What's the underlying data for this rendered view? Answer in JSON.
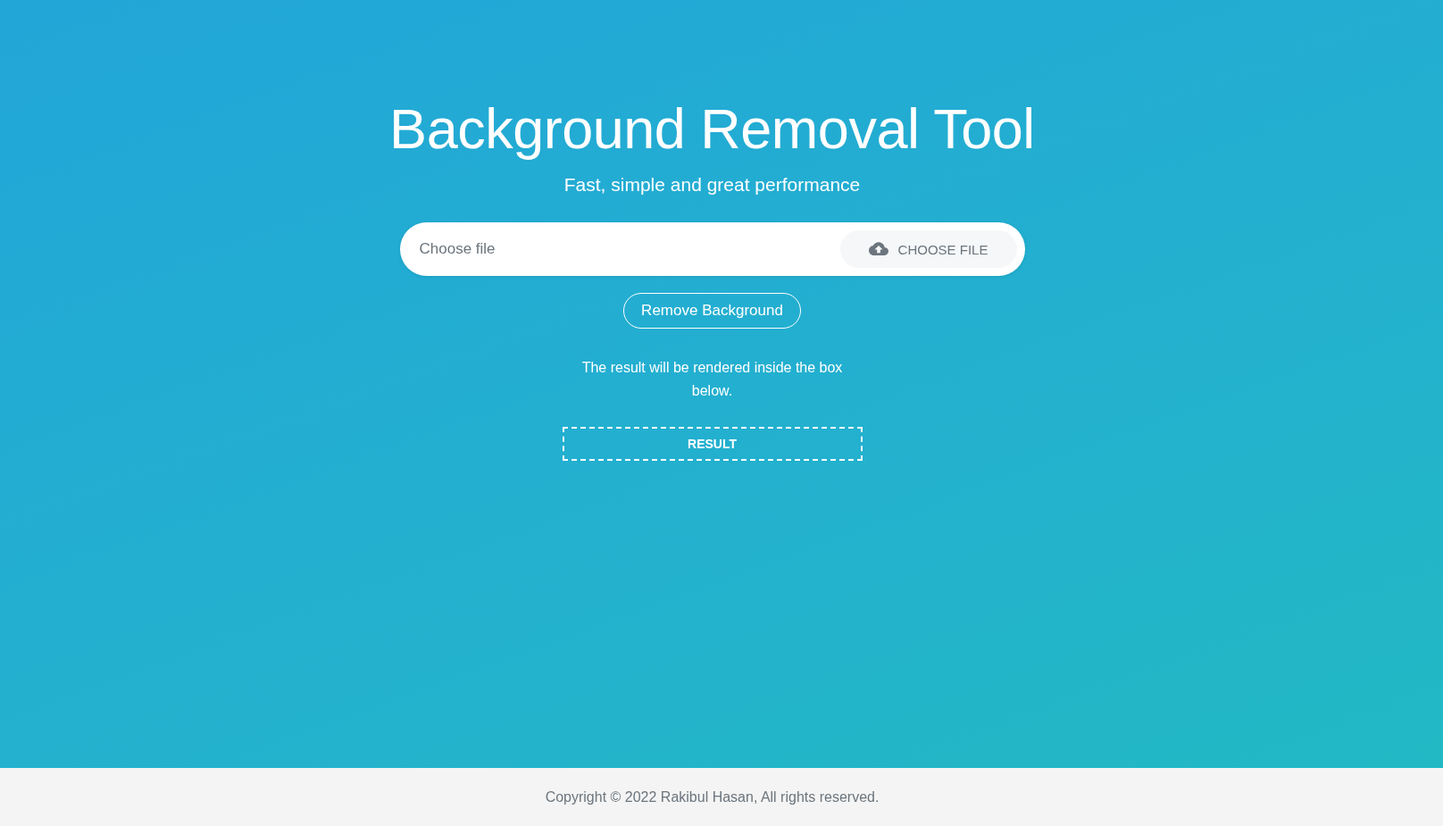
{
  "title": "Background Removal Tool",
  "subtitle": "Fast, simple and great performance",
  "file_input": {
    "placeholder": "Choose file",
    "button": "CHOOSE FILE"
  },
  "remove_button": "Remove Background",
  "note": "The result will be rendered inside the box below.",
  "result_box": {
    "label": "RESULT"
  },
  "footer": {
    "text": "Copyright © 2022 Rakibul Hasan, All rights reserved."
  }
}
